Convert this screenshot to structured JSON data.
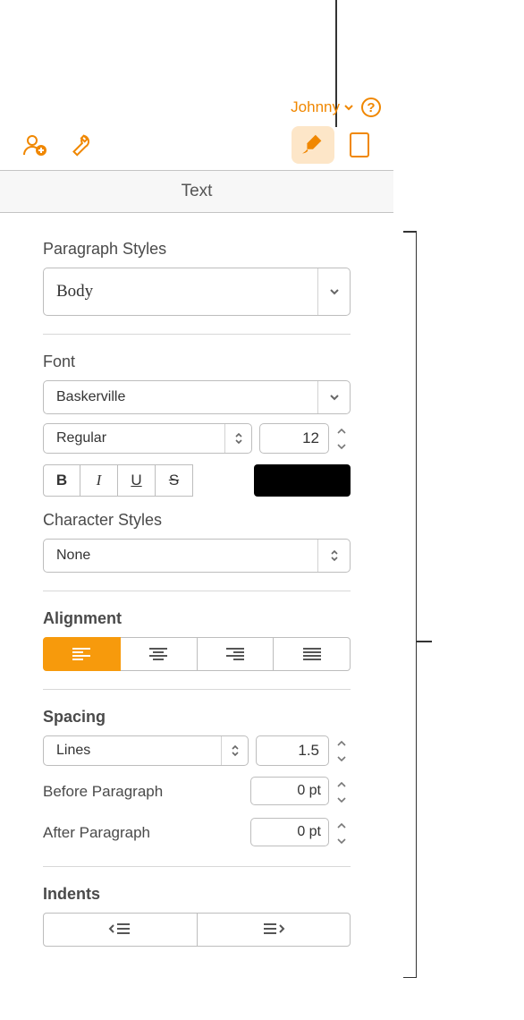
{
  "header": {
    "user": "Johnny",
    "help": "?"
  },
  "section_title": "Text",
  "paragraph_styles": {
    "label": "Paragraph Styles",
    "value": "Body"
  },
  "font": {
    "label": "Font",
    "family": "Baskerville",
    "style": "Regular",
    "size": "12",
    "bold": "B",
    "italic": "I",
    "underline": "U",
    "strike": "S",
    "color": "#000000"
  },
  "character_styles": {
    "label": "Character Styles",
    "value": "None"
  },
  "alignment": {
    "label": "Alignment",
    "selected": "left"
  },
  "spacing": {
    "label": "Spacing",
    "mode": "Lines",
    "value": "1.5",
    "before_label": "Before Paragraph",
    "before_value": "0 pt",
    "after_label": "After Paragraph",
    "after_value": "0 pt"
  },
  "indents": {
    "label": "Indents"
  }
}
